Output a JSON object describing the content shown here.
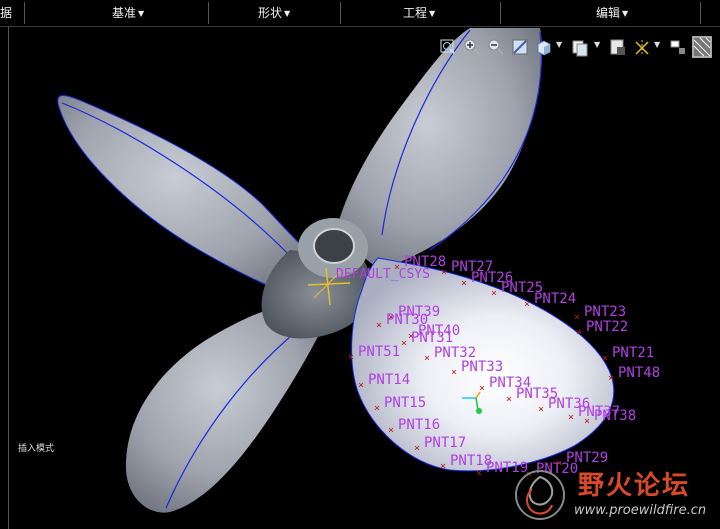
{
  "menu": {
    "items": [
      {
        "label": "据",
        "caret": false
      },
      {
        "label": "基准",
        "caret": true
      },
      {
        "label": "形状",
        "caret": true
      },
      {
        "label": "工程",
        "caret": true
      },
      {
        "label": "编辑",
        "caret": true
      }
    ]
  },
  "viewport": {
    "status_text": "插入模式",
    "datum_label": "DEFAULT_CSYS",
    "points": [
      {
        "label": "PNT28"
      },
      {
        "label": "PNT27"
      },
      {
        "label": "PNT26"
      },
      {
        "label": "PNT25"
      },
      {
        "label": "PNT24"
      },
      {
        "label": "PNT23"
      },
      {
        "label": "PNT22"
      },
      {
        "label": "PNT21"
      },
      {
        "label": "PNT48"
      },
      {
        "label": "PNT39"
      },
      {
        "label": "PNT30"
      },
      {
        "label": "PNT40"
      },
      {
        "label": "PNT31"
      },
      {
        "label": "PNT51"
      },
      {
        "label": "PNT32"
      },
      {
        "label": "PNT14"
      },
      {
        "label": "PNT33"
      },
      {
        "label": "PNT34"
      },
      {
        "label": "PNT35"
      },
      {
        "label": "PNT15"
      },
      {
        "label": "PNT36"
      },
      {
        "label": "PNT37"
      },
      {
        "label": "PNT38"
      },
      {
        "label": "PNT16"
      },
      {
        "label": "PNT17"
      },
      {
        "label": "PNT18"
      },
      {
        "label": "PNT19"
      },
      {
        "label": "PNT20"
      },
      {
        "label": "PNT29"
      }
    ]
  },
  "toolbar": {
    "icons": [
      "zoom-fit-icon",
      "zoom-in-icon",
      "zoom-out-icon",
      "repaint-icon",
      "saved-views-icon",
      "display-style-icon",
      "view-manager-icon",
      "datum-display-icon",
      "spin-center-icon",
      "annotation-display-icon",
      "appearance-icon"
    ]
  },
  "watermark": {
    "title": "野火论坛",
    "url": "www.proewildfire.cn"
  },
  "colors": {
    "background": "#000000",
    "point_label": "#b040e0",
    "point_marker": "#c01818",
    "blade_edge": "#1a2ae0",
    "watermark_red": "#d94a28"
  }
}
